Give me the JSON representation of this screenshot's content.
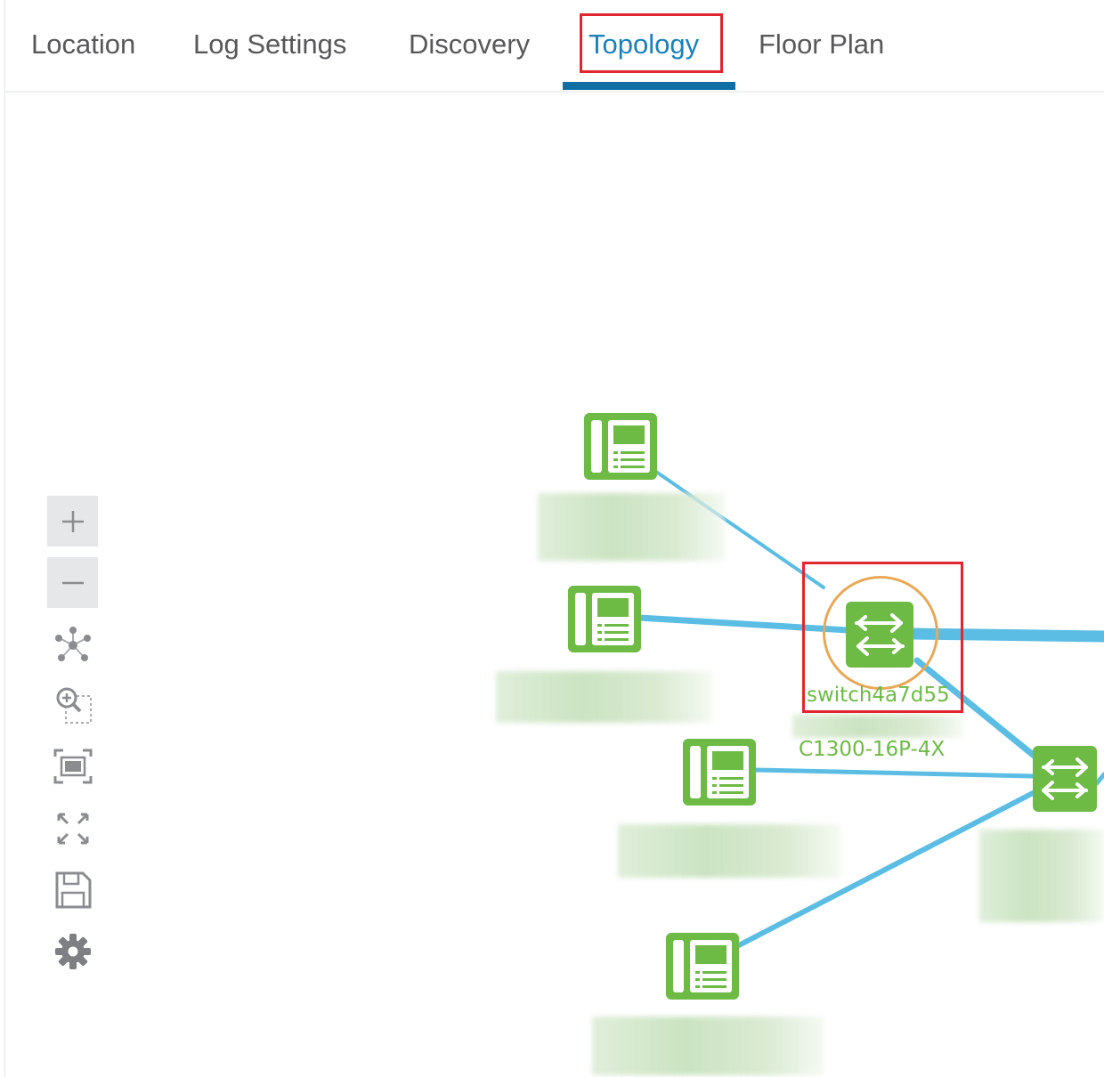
{
  "tabs": [
    {
      "label": "Location"
    },
    {
      "label": "Log Settings"
    },
    {
      "label": "Discovery"
    },
    {
      "label": "Topology",
      "active": true
    },
    {
      "label": "Floor Plan"
    }
  ],
  "toolbar": {
    "items": [
      "zoom-in-icon",
      "zoom-out-icon",
      "layout-icon",
      "zoom-selection-icon",
      "fit-view-icon",
      "fullscreen-icon",
      "save-icon",
      "settings-icon"
    ]
  },
  "topology": {
    "selected_switch": {
      "name": "switch4a7d55",
      "model": "C1300-16P-4X"
    }
  },
  "colors": {
    "accent": "#1a81bc",
    "tab_underline": "#0f6fa4",
    "node_green": "#6dbb45",
    "link_blue": "#5bbde4",
    "highlight_red": "#e0262f",
    "selection_ring": "#e9a855"
  }
}
